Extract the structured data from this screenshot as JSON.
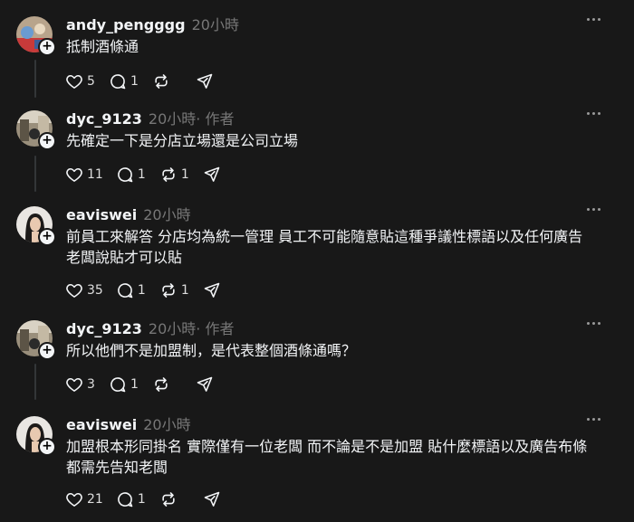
{
  "posts": [
    {
      "username": "andy_pengggg",
      "time": "20小時",
      "is_author": false,
      "text": [
        "抵制酒條通"
      ],
      "likes": "5",
      "replies": "1",
      "reposts": "",
      "avatar": "avatar-a"
    },
    {
      "username": "dyc_9123",
      "time": "20小時",
      "is_author": true,
      "author_label": " · 作者",
      "text": [
        "先確定一下是分店立場還是公司立場"
      ],
      "likes": "11",
      "replies": "1",
      "reposts": "1",
      "avatar": "avatar-d"
    },
    {
      "username": "eaviswei",
      "time": "20小時",
      "is_author": false,
      "text": [
        "前員工來解答 分店均為統一管理 員工不可能隨意貼這種爭議性標語以及任何廣告",
        "老闆說貼才可以貼"
      ],
      "likes": "35",
      "replies": "1",
      "reposts": "1",
      "avatar": "avatar-e"
    },
    {
      "username": "dyc_9123",
      "time": "20小時",
      "is_author": true,
      "author_label": " · 作者",
      "text": [
        "所以他們不是加盟制，是代表整個酒條通嗎？"
      ],
      "likes": "3",
      "replies": "1",
      "reposts": "",
      "avatar": "avatar-d"
    },
    {
      "username": "eaviswei",
      "time": "20小時",
      "is_author": false,
      "text": [
        "加盟根本形同掛名 實際僅有一位老闆 而不論是不是加盟 貼什麼標語以及廣告布條",
        "都需先告知老闆"
      ],
      "likes": "21",
      "replies": "1",
      "reposts": "",
      "avatar": "avatar-e"
    }
  ],
  "icons": {
    "like": "heart-icon",
    "reply": "comment-icon",
    "repost": "repost-icon",
    "share": "share-icon",
    "more": "more-icon",
    "follow": "plus-icon"
  }
}
